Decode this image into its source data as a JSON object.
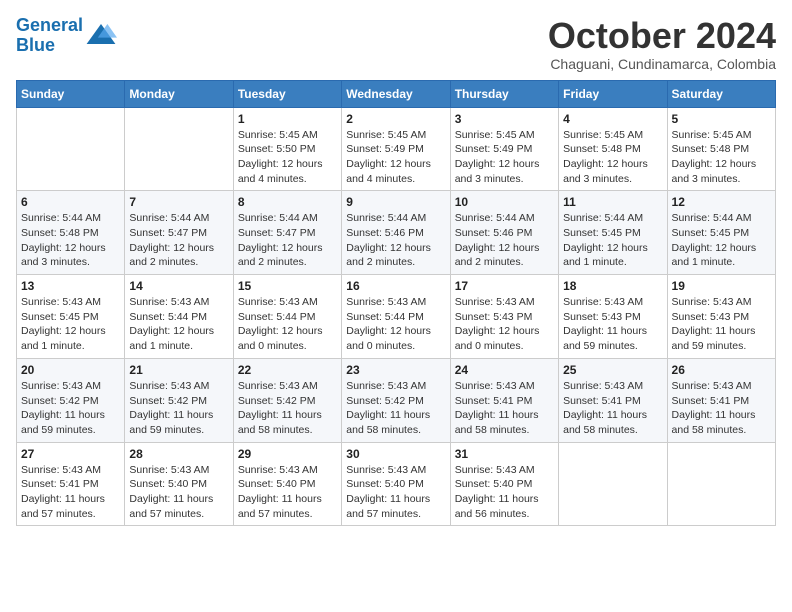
{
  "logo": {
    "text_general": "General",
    "text_blue": "Blue"
  },
  "header": {
    "month_title": "October 2024",
    "subtitle": "Chaguani, Cundinamarca, Colombia"
  },
  "weekdays": [
    "Sunday",
    "Monday",
    "Tuesday",
    "Wednesday",
    "Thursday",
    "Friday",
    "Saturday"
  ],
  "weeks": [
    [
      {
        "day": "",
        "info": ""
      },
      {
        "day": "",
        "info": ""
      },
      {
        "day": "1",
        "info": "Sunrise: 5:45 AM\nSunset: 5:50 PM\nDaylight: 12 hours and 4 minutes."
      },
      {
        "day": "2",
        "info": "Sunrise: 5:45 AM\nSunset: 5:49 PM\nDaylight: 12 hours and 4 minutes."
      },
      {
        "day": "3",
        "info": "Sunrise: 5:45 AM\nSunset: 5:49 PM\nDaylight: 12 hours and 3 minutes."
      },
      {
        "day": "4",
        "info": "Sunrise: 5:45 AM\nSunset: 5:48 PM\nDaylight: 12 hours and 3 minutes."
      },
      {
        "day": "5",
        "info": "Sunrise: 5:45 AM\nSunset: 5:48 PM\nDaylight: 12 hours and 3 minutes."
      }
    ],
    [
      {
        "day": "6",
        "info": "Sunrise: 5:44 AM\nSunset: 5:48 PM\nDaylight: 12 hours and 3 minutes."
      },
      {
        "day": "7",
        "info": "Sunrise: 5:44 AM\nSunset: 5:47 PM\nDaylight: 12 hours and 2 minutes."
      },
      {
        "day": "8",
        "info": "Sunrise: 5:44 AM\nSunset: 5:47 PM\nDaylight: 12 hours and 2 minutes."
      },
      {
        "day": "9",
        "info": "Sunrise: 5:44 AM\nSunset: 5:46 PM\nDaylight: 12 hours and 2 minutes."
      },
      {
        "day": "10",
        "info": "Sunrise: 5:44 AM\nSunset: 5:46 PM\nDaylight: 12 hours and 2 minutes."
      },
      {
        "day": "11",
        "info": "Sunrise: 5:44 AM\nSunset: 5:45 PM\nDaylight: 12 hours and 1 minute."
      },
      {
        "day": "12",
        "info": "Sunrise: 5:44 AM\nSunset: 5:45 PM\nDaylight: 12 hours and 1 minute."
      }
    ],
    [
      {
        "day": "13",
        "info": "Sunrise: 5:43 AM\nSunset: 5:45 PM\nDaylight: 12 hours and 1 minute."
      },
      {
        "day": "14",
        "info": "Sunrise: 5:43 AM\nSunset: 5:44 PM\nDaylight: 12 hours and 1 minute."
      },
      {
        "day": "15",
        "info": "Sunrise: 5:43 AM\nSunset: 5:44 PM\nDaylight: 12 hours and 0 minutes."
      },
      {
        "day": "16",
        "info": "Sunrise: 5:43 AM\nSunset: 5:44 PM\nDaylight: 12 hours and 0 minutes."
      },
      {
        "day": "17",
        "info": "Sunrise: 5:43 AM\nSunset: 5:43 PM\nDaylight: 12 hours and 0 minutes."
      },
      {
        "day": "18",
        "info": "Sunrise: 5:43 AM\nSunset: 5:43 PM\nDaylight: 11 hours and 59 minutes."
      },
      {
        "day": "19",
        "info": "Sunrise: 5:43 AM\nSunset: 5:43 PM\nDaylight: 11 hours and 59 minutes."
      }
    ],
    [
      {
        "day": "20",
        "info": "Sunrise: 5:43 AM\nSunset: 5:42 PM\nDaylight: 11 hours and 59 minutes."
      },
      {
        "day": "21",
        "info": "Sunrise: 5:43 AM\nSunset: 5:42 PM\nDaylight: 11 hours and 59 minutes."
      },
      {
        "day": "22",
        "info": "Sunrise: 5:43 AM\nSunset: 5:42 PM\nDaylight: 11 hours and 58 minutes."
      },
      {
        "day": "23",
        "info": "Sunrise: 5:43 AM\nSunset: 5:42 PM\nDaylight: 11 hours and 58 minutes."
      },
      {
        "day": "24",
        "info": "Sunrise: 5:43 AM\nSunset: 5:41 PM\nDaylight: 11 hours and 58 minutes."
      },
      {
        "day": "25",
        "info": "Sunrise: 5:43 AM\nSunset: 5:41 PM\nDaylight: 11 hours and 58 minutes."
      },
      {
        "day": "26",
        "info": "Sunrise: 5:43 AM\nSunset: 5:41 PM\nDaylight: 11 hours and 58 minutes."
      }
    ],
    [
      {
        "day": "27",
        "info": "Sunrise: 5:43 AM\nSunset: 5:41 PM\nDaylight: 11 hours and 57 minutes."
      },
      {
        "day": "28",
        "info": "Sunrise: 5:43 AM\nSunset: 5:40 PM\nDaylight: 11 hours and 57 minutes."
      },
      {
        "day": "29",
        "info": "Sunrise: 5:43 AM\nSunset: 5:40 PM\nDaylight: 11 hours and 57 minutes."
      },
      {
        "day": "30",
        "info": "Sunrise: 5:43 AM\nSunset: 5:40 PM\nDaylight: 11 hours and 57 minutes."
      },
      {
        "day": "31",
        "info": "Sunrise: 5:43 AM\nSunset: 5:40 PM\nDaylight: 11 hours and 56 minutes."
      },
      {
        "day": "",
        "info": ""
      },
      {
        "day": "",
        "info": ""
      }
    ]
  ]
}
